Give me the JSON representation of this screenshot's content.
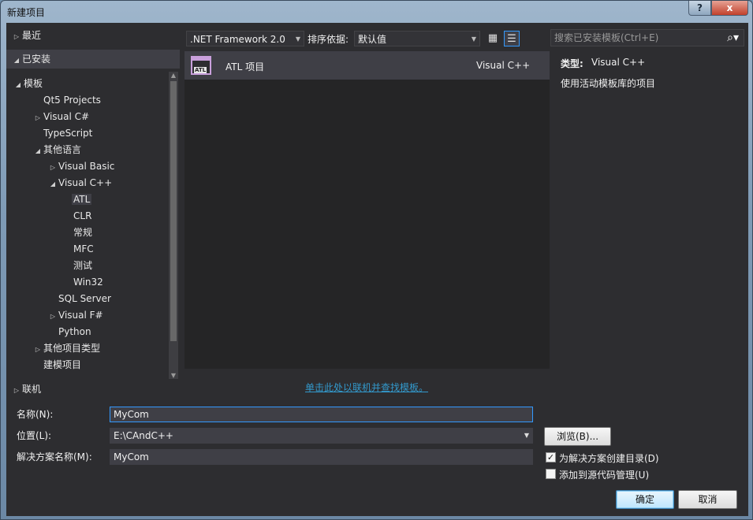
{
  "window": {
    "title": "新建项目",
    "help_label": "?",
    "close_label": "x"
  },
  "left_panel": {
    "recent_label": "最近",
    "installed_label": "已安装",
    "templates_label": "模板",
    "tree": {
      "qt5": "Qt5 Projects",
      "vcsharp": "Visual C#",
      "typescript": "TypeScript",
      "other_lang": "其他语言",
      "vbasic": "Visual Basic",
      "vcpp": "Visual C++",
      "atl": "ATL",
      "clr": "CLR",
      "general": "常规",
      "mfc": "MFC",
      "test": "测试",
      "win32": "Win32",
      "sqlserver": "SQL Server",
      "vfsharp": "Visual F#",
      "python": "Python",
      "other_proj": "其他项目类型",
      "modeling": "建模项目"
    },
    "online_label": "联机"
  },
  "toolbar": {
    "framework_value": ".NET Framework 2.0",
    "sort_label": "排序依据:",
    "sort_value": "默认值"
  },
  "templates": [
    {
      "name": "ATL 项目",
      "lang": "Visual C++",
      "icon": "atl-icon"
    }
  ],
  "online_link": "单击此处以联机并查找模板。",
  "details": {
    "search_placeholder": "搜索已安装模板(Ctrl+E)",
    "type_label": "类型:",
    "type_value": "Visual C++",
    "description": "使用活动模板库的项目"
  },
  "form": {
    "name_label": "名称(N):",
    "name_value": "MyCom",
    "location_label": "位置(L):",
    "location_value": "E:\\CAndC++",
    "solution_label": "解决方案名称(M):",
    "solution_value": "MyCom",
    "browse_label": "浏览(B)...",
    "create_dir_label": "为解决方案创建目录(D)",
    "create_dir_checked": true,
    "source_control_label": "添加到源代码管理(U)",
    "source_control_checked": false,
    "ok_label": "确定",
    "cancel_label": "取消"
  }
}
